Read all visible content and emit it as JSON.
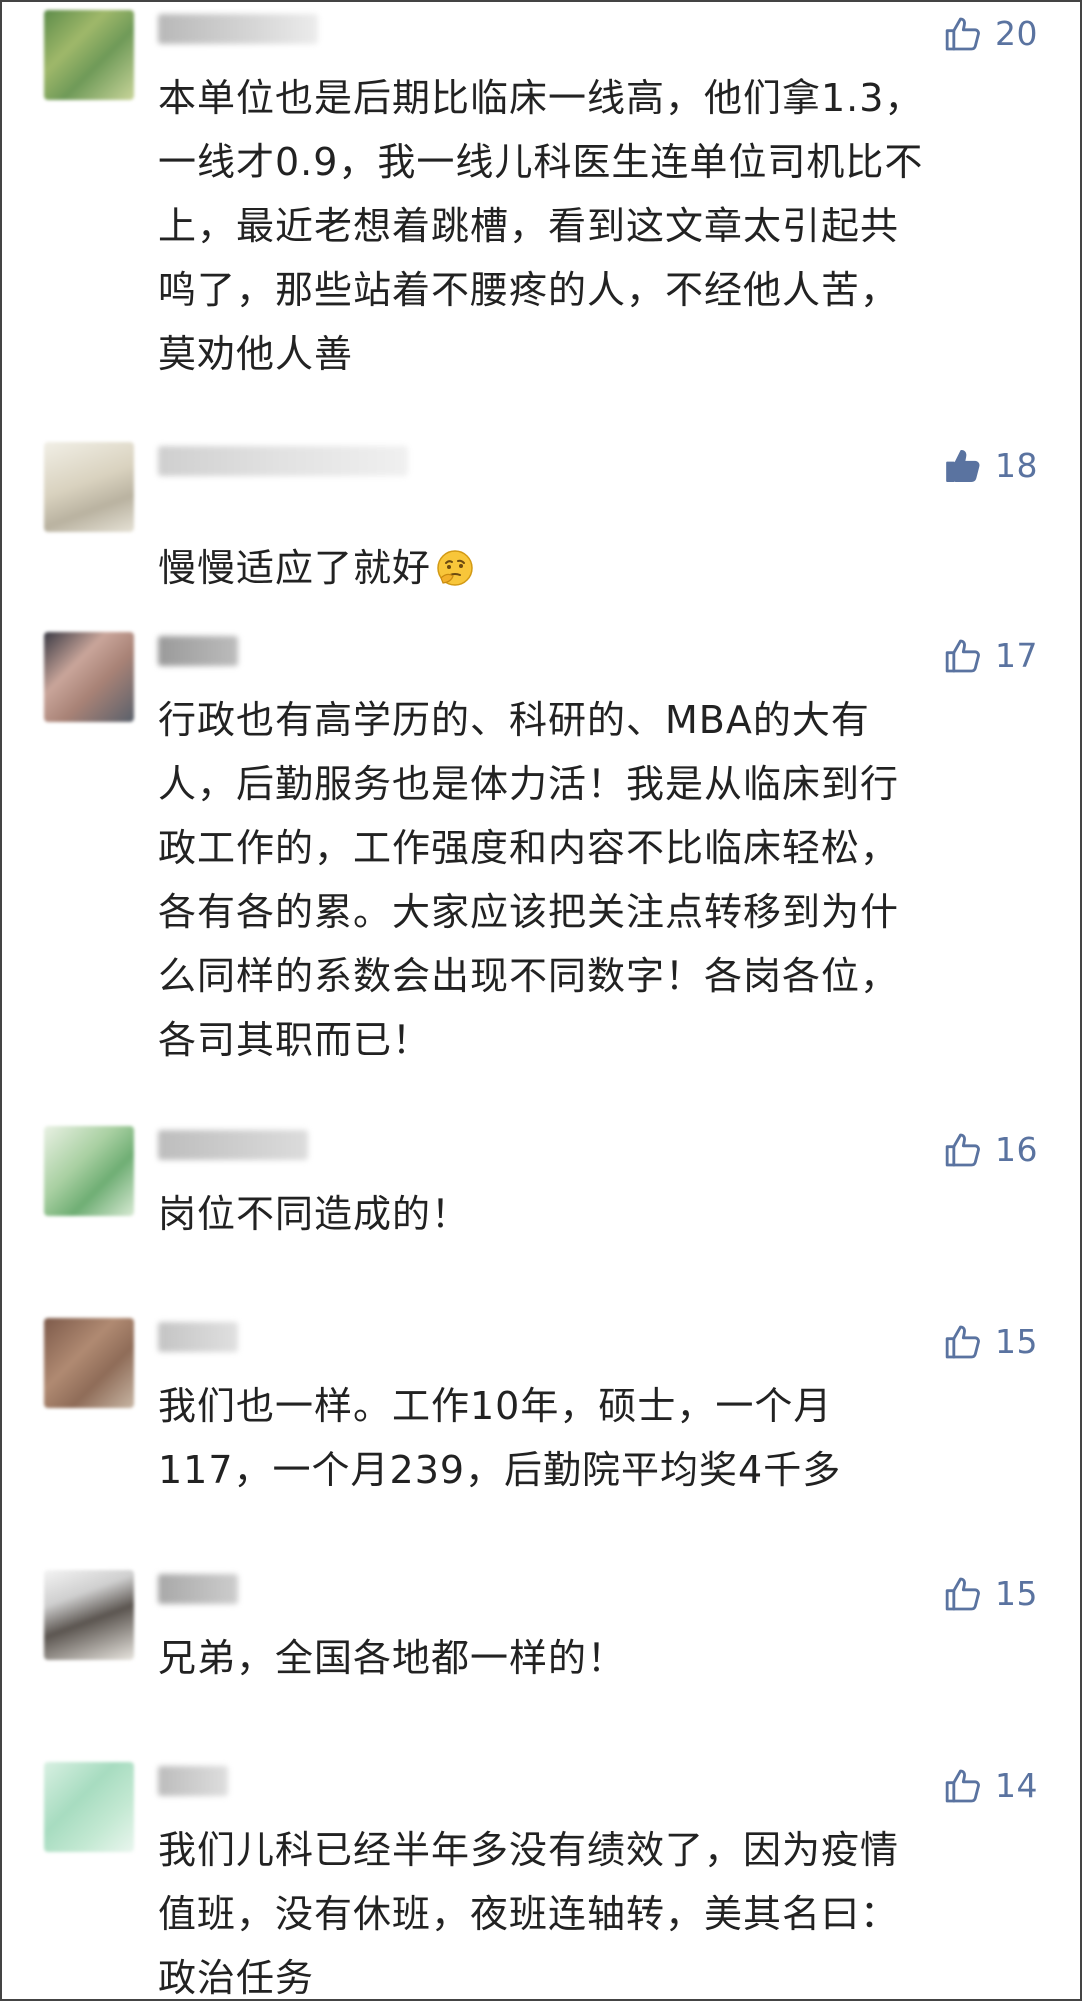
{
  "comments": [
    {
      "likes": "20",
      "text": "本单位也是后期比临床一线高，他们拿1.3，\n一线才0.9，我一线儿科医生连单位司机比不\n上，最近老想着跳槽，看到这文章太引起共\n鸣了，那些站着不腰疼的人，不经他人苦，\n莫劝他人善",
      "like_icon": "thumbs-up-outline-icon"
    },
    {
      "likes": "18",
      "text": "慢慢适应了就好",
      "emoji": "thinking-face-emoji",
      "like_icon": "thumbs-up-filled-icon"
    },
    {
      "likes": "17",
      "text": "行政也有高学历的、科研的、MBA的大有\n人，后勤服务也是体力活！我是从临床到行\n政工作的，工作强度和内容不比临床轻松，\n各有各的累。大家应该把关注点转移到为什\n么同样的系数会出现不同数字！各岗各位，\n各司其职而已！",
      "like_icon": "thumbs-up-outline-icon"
    },
    {
      "likes": "16",
      "text": "岗位不同造成的！",
      "like_icon": "thumbs-up-outline-icon"
    },
    {
      "likes": "15",
      "text": "我们也一样。工作10年，硕士，一个月\n117，一个月239，后勤院平均奖4千多",
      "like_icon": "thumbs-up-outline-icon"
    },
    {
      "likes": "15",
      "text": "兄弟，全国各地都一样的！",
      "like_icon": "thumbs-up-outline-icon"
    },
    {
      "likes": "14",
      "text": "我们儿科已经半年多没有绩效了，因为疫情\n值班，没有休班，夜班连轴转，美其名曰：\n政治任务",
      "like_icon": "thumbs-up-outline-icon"
    }
  ],
  "colors": {
    "like": "#5a73a0",
    "text": "#222222",
    "border": "#444444"
  }
}
